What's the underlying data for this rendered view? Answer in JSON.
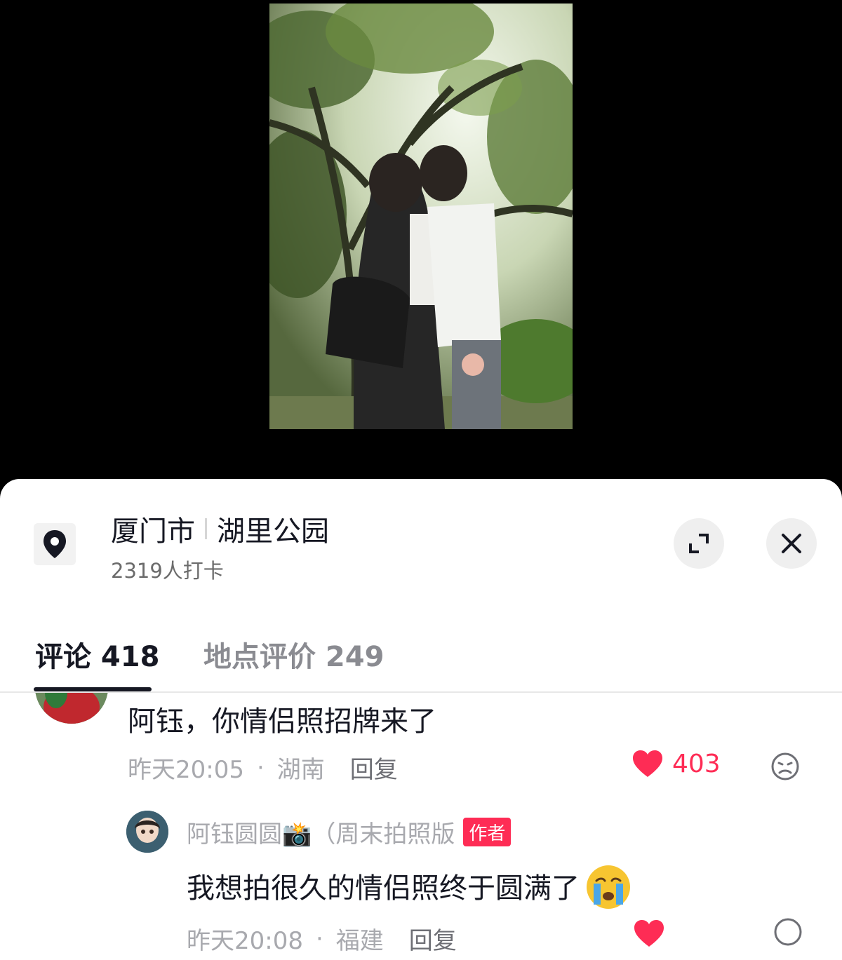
{
  "location": {
    "city": "厦门市",
    "place": "湖里公园",
    "checkins": "2319人打卡"
  },
  "tabs": {
    "comments": "评论 418",
    "reviews": "地点评价 249"
  },
  "comments": [
    {
      "text": "阿钰，你情侣照招牌来了",
      "time": "昨天20:05",
      "region": "湖南",
      "reply_label": "回复",
      "likes": "403"
    },
    {
      "author": "阿钰圆圆📸（周末拍照版",
      "author_badge": "作者",
      "text": "我想拍很久的情侣照终于圆满了",
      "time": "昨天20:08",
      "region": "福建",
      "reply_label": "回复"
    }
  ],
  "colors": {
    "accent": "#fe2c55",
    "text_primary": "#161823",
    "text_secondary": "#a8a9ae"
  },
  "icons": [
    "location-pin-icon",
    "expand-icon",
    "close-icon",
    "heart-icon",
    "dislike-face-icon",
    "crying-emoji-icon"
  ]
}
